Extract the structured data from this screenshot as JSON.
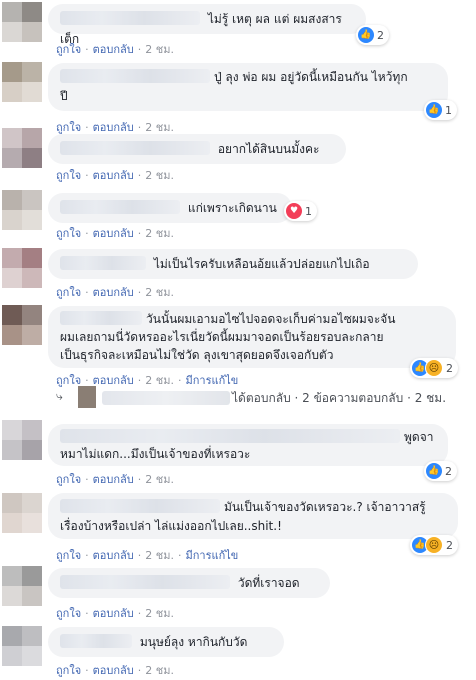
{
  "actions": {
    "like": "ถูกใจ",
    "reply": "ตอบกลับ",
    "edited": "มีการแก้ไข"
  },
  "comments": [
    {
      "text": "ไม่รู้ เหตุ ผล แต่ ผมสงสารเต็ก",
      "time": "2 ชม.",
      "reaction_count": "2",
      "avatar_colors": [
        "#8e8a86",
        "#c7c2bd"
      ]
    },
    {
      "text": "ปู่ ลุง พ่อ ผม อยู่วัดนี้เหมือนกัน ไหว้ทุกปี",
      "line1": "ปู่ ลุง พ่อ ผม อยู่วัดนี้เหมือนกัน ไหว้ทุก",
      "line2": "ปี",
      "time": "2 ชม.",
      "reaction_count": "1",
      "avatar_colors": [
        "#a59a8a",
        "#d7cfc6"
      ]
    },
    {
      "text": "อยากได้สินบนมั้งคะ",
      "time": "2 ชม.",
      "avatar_colors": [
        "#b7a6a9",
        "#8e7f84"
      ]
    },
    {
      "text": "แก่เพราะเกิดนาน",
      "time": "2 ชม.",
      "reaction_count": "1",
      "avatar_colors": [
        "#b9b2ac",
        "#d9d3cd"
      ]
    },
    {
      "text": "ไม่เป็นไรครับเหลือนอ้ยแล้วปล่อยแกไปเถิอ",
      "time": "2 ชม.",
      "avatar_colors": [
        "#a47f83",
        "#cdb8b9"
      ]
    },
    {
      "line1": "วันนั้นผมเอามอไซไปจอดจะเก็บค่ามอไซผมจะจัน",
      "line2": "ผมเลยถามนี่วัดหรออะไรเนี่ยวัดนี้ผมมาจอดเป็นร้อยรอบละกลาย",
      "line3": "เป็นธุรกิจละเหมือนไม่ใช่วัด ลุงเขาสุดยอดจึงเจอกับตัว",
      "time": "2 ชม.",
      "reaction_count": "2",
      "edited": true,
      "avatar_colors": [
        "#6f5b55",
        "#a89287"
      ]
    },
    {
      "line1": "พูดจา",
      "line2": "หมาไม่แดก...มึงเป็นเจ้าของที่เหรอวะ",
      "time": "2 ชม.",
      "reaction_count": "2",
      "avatar_colors": [
        "#c4c0c5",
        "#a7a3a9"
      ]
    },
    {
      "line1": "มันเป็นเจ้าของวัดเหรอวะ.? เจ้าอาวาสรู้",
      "line2": "เรื่องบ้างหรือเปล่า ไล่แม่งออกไปเลย..shit.!",
      "time": "2 ชม.",
      "reaction_count": "2",
      "edited": true,
      "avatar_colors": [
        "#cfc7c1",
        "#e0d6d0"
      ]
    },
    {
      "text": "วัดที่เราจอด",
      "time": "2 ชม.",
      "avatar_colors": [
        "#9a9a9a",
        "#c9c5c2"
      ]
    },
    {
      "text": "มนุษย์ลุง หากินกับวัด",
      "time": "2 ชม.",
      "avatar_colors": [
        "#a8a9ad",
        "#cfcfd3"
      ]
    }
  ],
  "reply_summary": {
    "text": "ได้ตอบกลับ · 2 ข้อความตอบกลับ · 2 ชม."
  }
}
